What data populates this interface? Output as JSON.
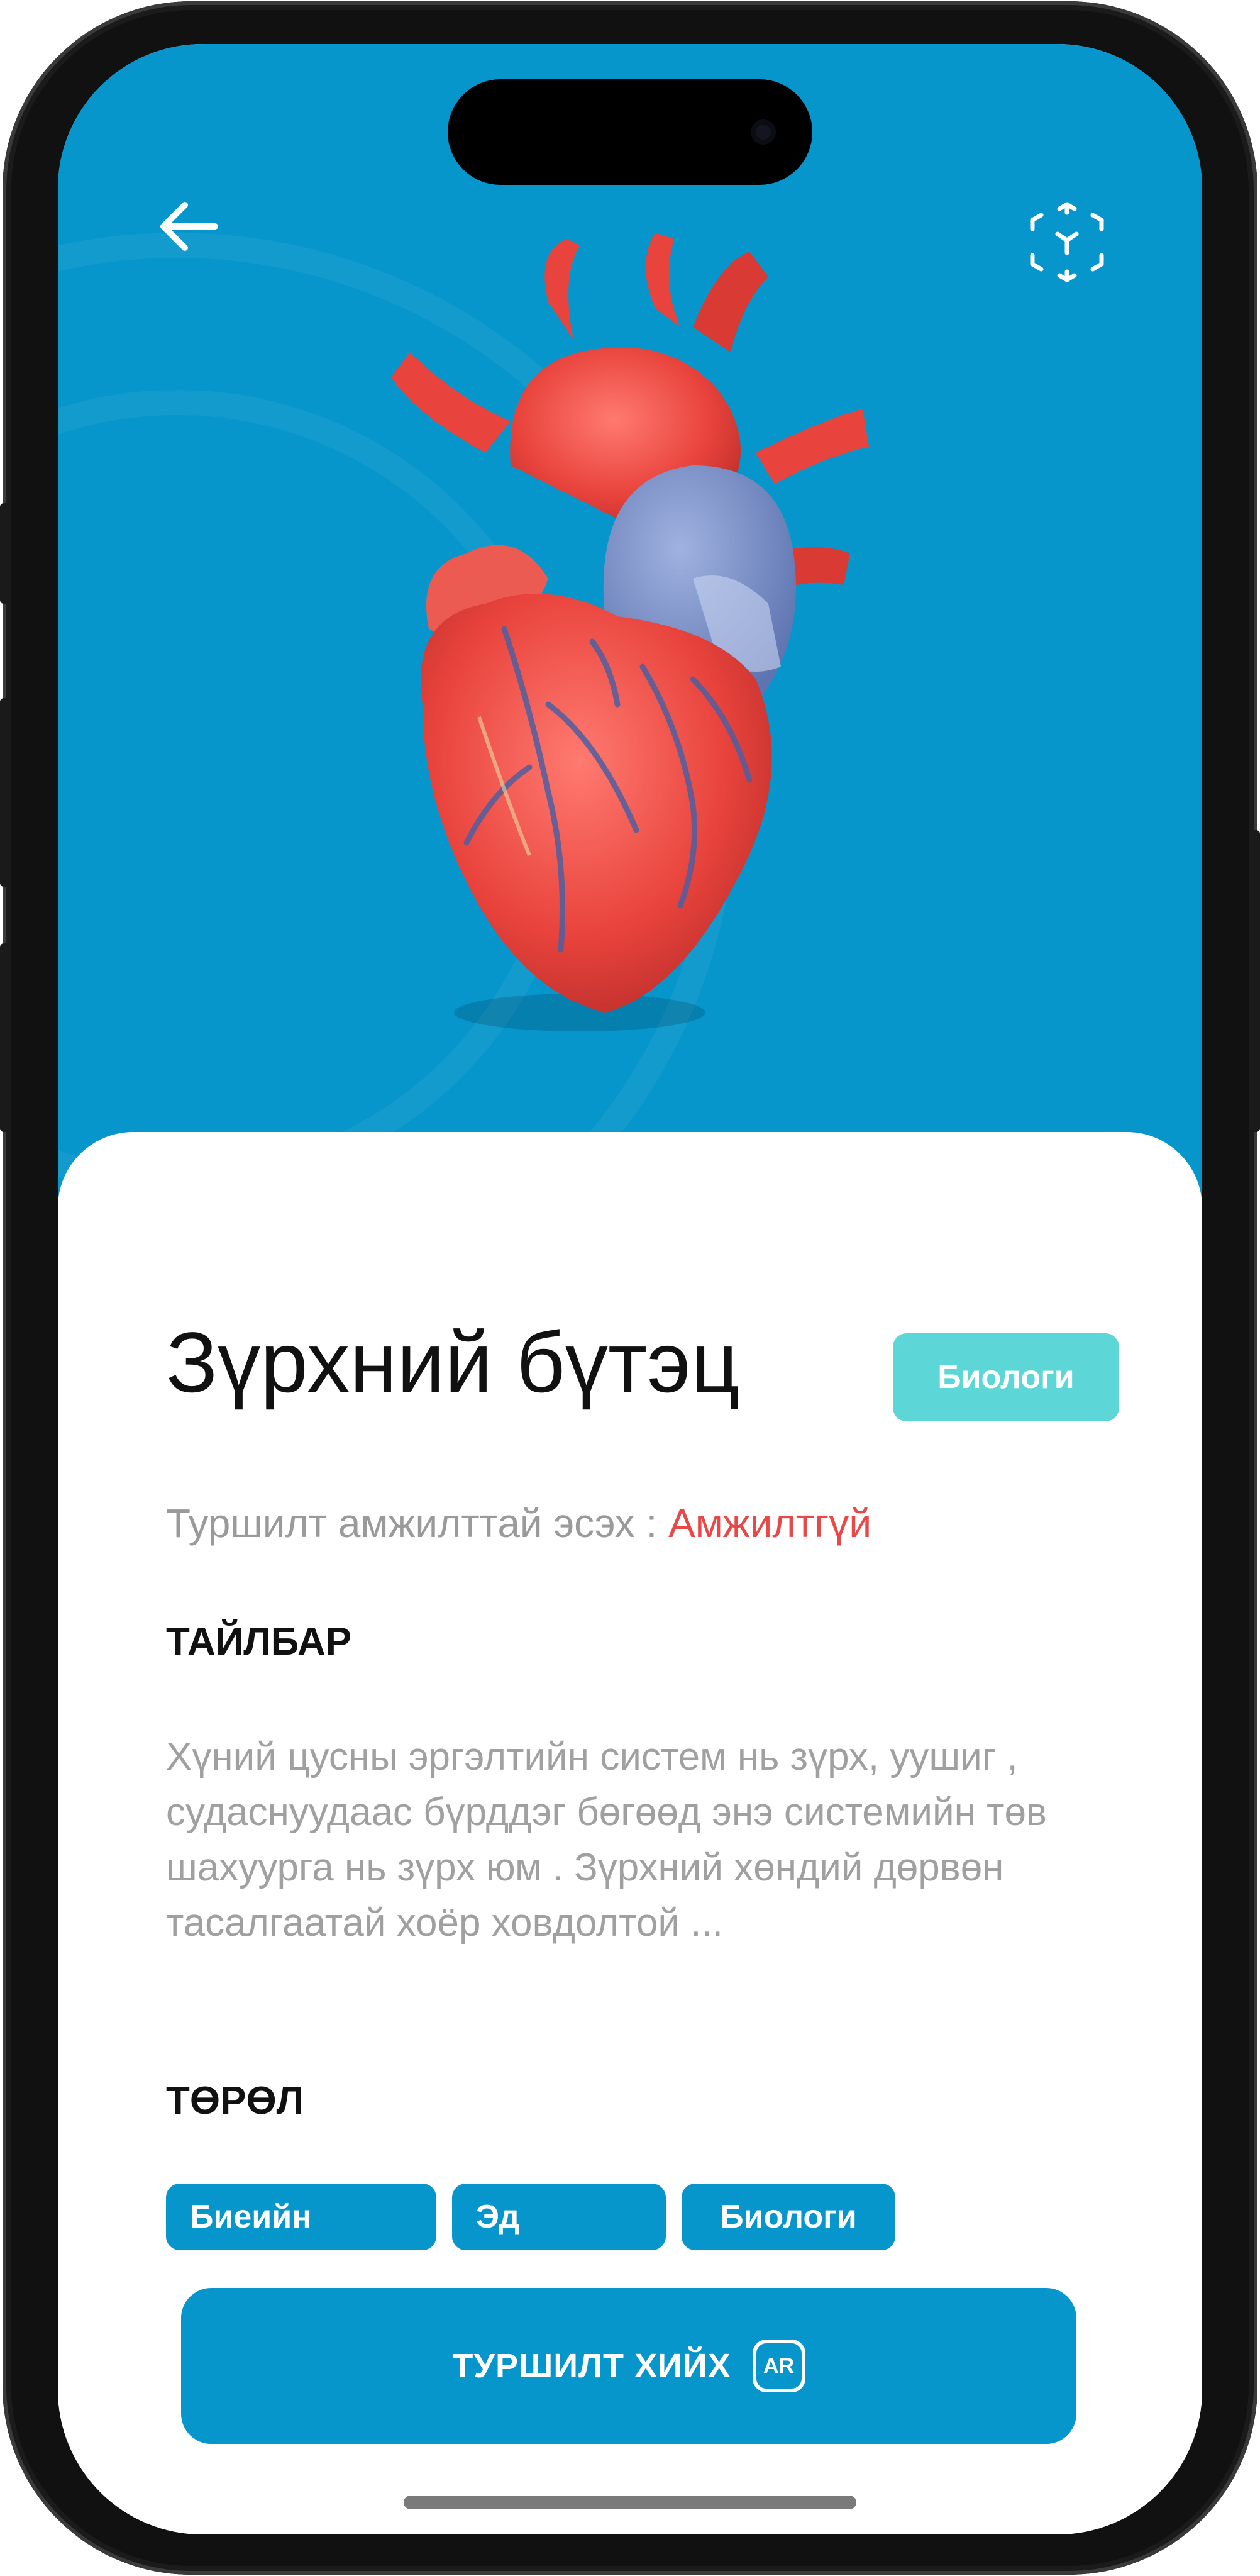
{
  "colors": {
    "hero_bg": "#0796cc",
    "accent": "#0796cc",
    "category_badge_bg": "#5cd6d6",
    "status_fail": "#e84848",
    "muted_text": "#9a9a9a",
    "title_text": "#111111"
  },
  "header": {
    "back_icon": "arrow-left-icon",
    "ar_icon": "ar-scan-icon"
  },
  "hero": {
    "image": "heart-anatomy-illustration"
  },
  "detail": {
    "title": "Зүрхний бүтэц",
    "category_badge": "Биологи",
    "status_label": "Туршилт амжилттай эсэх :",
    "status_value": "Амжилтгүй",
    "description_heading": "ТАЙЛБАР",
    "description": "Хүний цусны эргэлтийн систем нь зүрх, уушиг , судаснуудаас бүрддэг бөгөөд энэ системийн төв шахуурга нь зүрх юм . Зүрхний хөндий дөрвөн тасалгаатай хоёр ховдолтой ...",
    "type_heading": "ТӨРӨЛ",
    "tags": [
      "Биеийн",
      "Эд",
      "Биологи"
    ]
  },
  "action": {
    "label": "ТУРШИЛТ ХИЙХ",
    "badge": "AR"
  }
}
